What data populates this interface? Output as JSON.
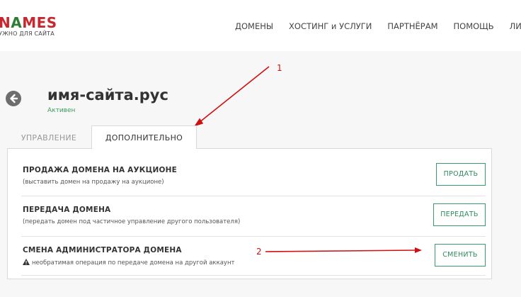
{
  "header": {
    "logo": {
      "word_n": "N",
      "word_a": "A",
      "word_mes": "MES",
      "subtitle": "УЖНО ДЛЯ САЙТА"
    },
    "nav": [
      {
        "label": "ДОМЕНЫ"
      },
      {
        "label": "ХОСТИНГ и УСЛУГИ"
      },
      {
        "label": "ПАРТНЁРАМ"
      },
      {
        "label": "ПОМОЩЬ"
      },
      {
        "label": "ЛИЧН"
      }
    ]
  },
  "domain": {
    "name": "имя-сайта.рус",
    "status": "Активен"
  },
  "tabs": [
    {
      "label": "УПРАВЛЕНИЕ"
    },
    {
      "label": "ДОПОЛНИТЕЛЬНО"
    }
  ],
  "rows": [
    {
      "title": "ПРОДАЖА ДОМЕНА НА АУКЦИОНЕ",
      "desc": "(выставить домен на продажу на аукционе)",
      "button": "ПРОДАТЬ"
    },
    {
      "title": "ПЕРЕДАЧА ДОМЕНА",
      "desc": "(передать домен под частичное управление другого пользователя)",
      "button": "ПЕРЕДАТЬ"
    },
    {
      "title": "СМЕНА АДМИНИСТРАТОРА ДОМЕНА",
      "desc": "необратимая операция по передаче домена на другой аккаунт",
      "button": "СМЕНИТЬ"
    }
  ],
  "annotations": {
    "one": "1",
    "two": "2",
    "color": "#d01010"
  },
  "colors": {
    "accent_green": "#3a9b6e",
    "brand_red": "#c8282d"
  }
}
